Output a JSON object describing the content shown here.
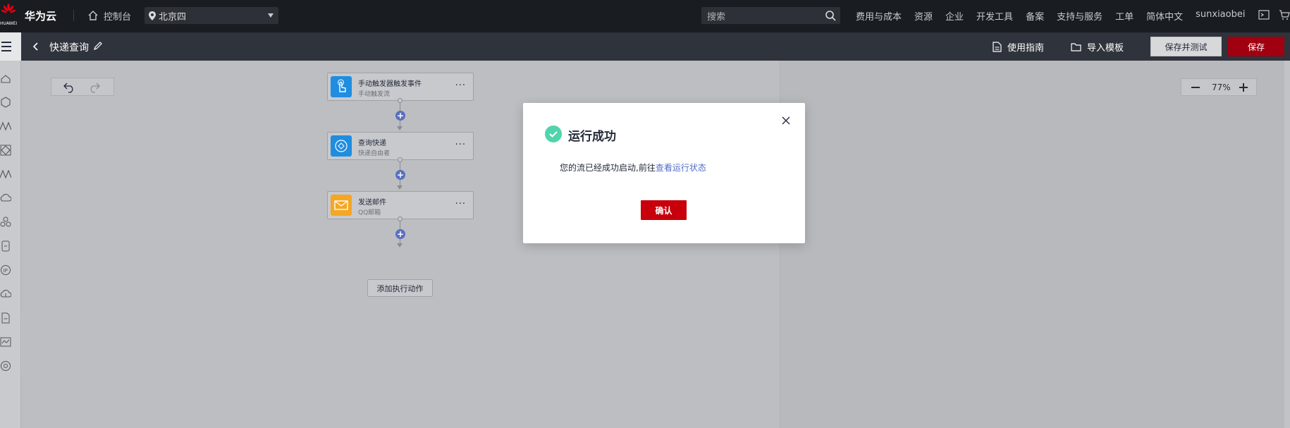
{
  "topbar": {
    "brand": "华为云",
    "logo_text": "HUAWEI",
    "console": "控制台",
    "region": "北京四",
    "search_placeholder": "搜索",
    "nav": [
      "费用与成本",
      "资源",
      "企业",
      "开发工具",
      "备案",
      "支持与服务",
      "工单",
      "简体中文",
      "sunxiaobei"
    ]
  },
  "header": {
    "title": "快递查询",
    "guide": "使用指南",
    "import": "导入模板",
    "save_test": "保存并测试",
    "save": "保存"
  },
  "canvas": {
    "zoom": "77%",
    "nodes": [
      {
        "title": "手动触发器触发事件",
        "subtitle": "手动触发流",
        "icon": "hand-touch-icon",
        "color": "#1f8de0"
      },
      {
        "title": "查询快递",
        "subtitle": "快递自由者",
        "icon": "express-query-icon",
        "color": "#1f8de0"
      },
      {
        "title": "发送邮件",
        "subtitle": "QQ邮箱",
        "icon": "mail-icon",
        "color": "#f5a623"
      }
    ],
    "add_action": "添加执行动作"
  },
  "modal": {
    "title": "运行成功",
    "body_prefix": "您的流已经成功启动,前往",
    "body_link": "查看运行状态",
    "confirm": "确认"
  },
  "colors": {
    "topbar_bg": "#191c20",
    "subbar_bg": "#2f333b",
    "accent_red": "#c7000b",
    "success_green": "#50d4ab",
    "link_blue": "#526ecc"
  }
}
